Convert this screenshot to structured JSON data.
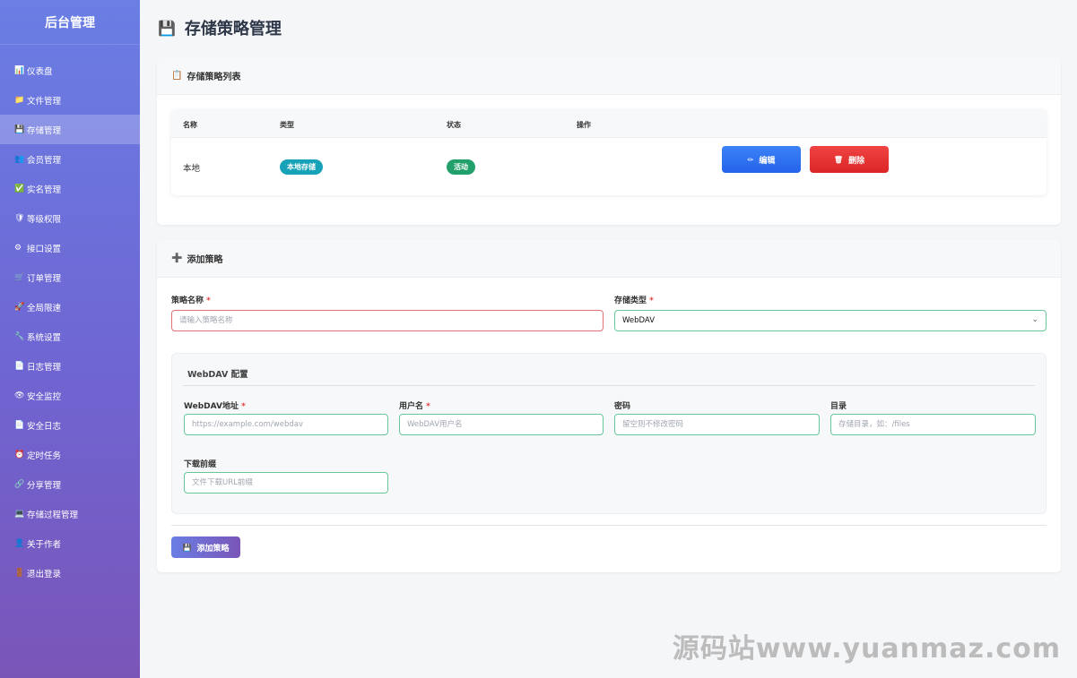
{
  "sidebar": {
    "brand": "后台管理",
    "items": [
      {
        "icon": "📊",
        "label": "仪表盘"
      },
      {
        "icon": "📁",
        "label": "文件管理"
      },
      {
        "icon": "💾",
        "label": "存储管理"
      },
      {
        "icon": "👥",
        "label": "会员管理"
      },
      {
        "icon": "✅",
        "label": "实名管理"
      },
      {
        "icon": "🛡",
        "label": "等级权限"
      },
      {
        "icon": "⚙",
        "label": "接口设置"
      },
      {
        "icon": "🛒",
        "label": "订单管理"
      },
      {
        "icon": "🚀",
        "label": "全局限速"
      },
      {
        "icon": "🔧",
        "label": "系统设置"
      },
      {
        "icon": "📄",
        "label": "日志管理"
      },
      {
        "icon": "👁",
        "label": "安全监控"
      },
      {
        "icon": "📄",
        "label": "安全日志"
      },
      {
        "icon": "⏰",
        "label": "定时任务"
      },
      {
        "icon": "🔗",
        "label": "分享管理"
      },
      {
        "icon": "💻",
        "label": "存储过程管理"
      },
      {
        "icon": "👤",
        "label": "关于作者"
      },
      {
        "icon": "🚪",
        "label": "退出登录"
      }
    ],
    "active_index": 2
  },
  "page": {
    "icon": "💾",
    "title": "存储策略管理"
  },
  "list_card": {
    "icon": "📋",
    "title": "存储策略列表",
    "columns": [
      "名称",
      "类型",
      "状态",
      "操作"
    ],
    "rows": [
      {
        "name": "本地",
        "type": "本地存储",
        "status": "活动",
        "edit": "编辑",
        "delete": "删除"
      }
    ],
    "edit_icon": "✏",
    "delete_icon": "🗑"
  },
  "add_card": {
    "icon": "➕",
    "title": "添加策略",
    "name_label": "策略名称",
    "name_placeholder": "请输入策略名称",
    "type_label": "存储类型",
    "type_value": "WebDAV",
    "required_mark": "*",
    "config_title": "WebDAV 配置",
    "url_label": "WebDAV地址",
    "url_placeholder": "https://example.com/webdav",
    "user_label": "用户名",
    "user_placeholder": "WebDAV用户名",
    "pass_label": "密码",
    "pass_placeholder": "留空则不修改密码",
    "dir_label": "目录",
    "dir_placeholder": "存储目录，如：/files",
    "prefix_label": "下载前缀",
    "prefix_placeholder": "文件下载URL前缀",
    "submit_icon": "💾",
    "submit_label": "添加策略"
  },
  "watermark": "源码站www.yuanmaz.com",
  "colors": {
    "accent": "#6a7ee4",
    "edit": "#2563eb",
    "delete": "#dc2626",
    "badge_type": "#17a2b8",
    "badge_status": "#22a06b"
  }
}
